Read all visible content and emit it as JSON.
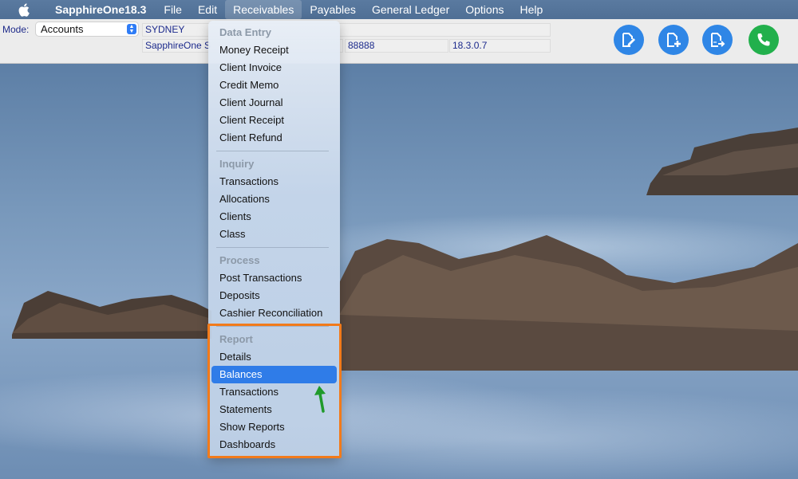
{
  "menubar": {
    "apple_icon": "apple-logo-icon",
    "app_name": "SapphireOne18.3",
    "items": [
      "File",
      "Edit",
      "Receivables",
      "Payables",
      "General Ledger",
      "Options",
      "Help"
    ],
    "active_item": "Receivables"
  },
  "toolbar": {
    "mode_label": "Mode:",
    "mode_value": "Accounts",
    "location": "SYDNEY",
    "company": "SapphireOne S",
    "code": "88888",
    "version": "18.3.0.7",
    "actions": [
      {
        "name": "edit-document",
        "icon": "document-edit-icon",
        "color": "#2f86e6"
      },
      {
        "name": "new-document",
        "icon": "document-add-icon",
        "color": "#2f86e6"
      },
      {
        "name": "export-document",
        "icon": "document-export-icon",
        "color": "#2f86e6"
      },
      {
        "name": "call-support",
        "icon": "phone-icon",
        "color": "#22b04c"
      }
    ]
  },
  "dropdown": {
    "sections": [
      {
        "header": "Data Entry",
        "items": [
          "Money Receipt",
          "Client Invoice",
          "Credit Memo",
          "Client Journal",
          "Client Receipt",
          "Client Refund"
        ]
      },
      {
        "header": "Inquiry",
        "items": [
          "Transactions",
          "Allocations",
          "Clients",
          "Class"
        ]
      },
      {
        "header": "Process",
        "items": [
          "Post Transactions",
          "Deposits",
          "Cashier Reconciliation"
        ]
      },
      {
        "header": "Report",
        "items": [
          "Details",
          "Balances",
          "Transactions",
          "Statements",
          "Show Reports",
          "Dashboards"
        ]
      }
    ],
    "selected_item": "Balances",
    "highlight_color": "#f27a1a",
    "arrow_color": "#1f9a2a"
  }
}
